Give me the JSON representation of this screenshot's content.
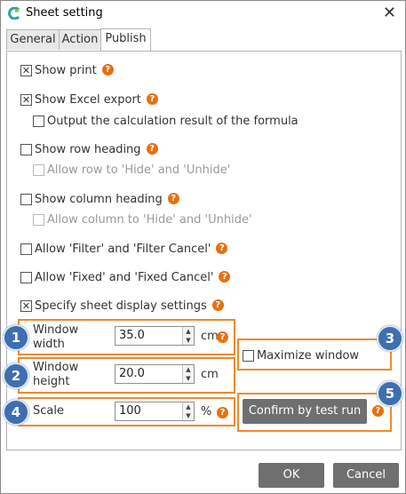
{
  "window": {
    "title": "Sheet setting",
    "close_glyph": "✕"
  },
  "tabs": [
    {
      "label": "General",
      "active": false
    },
    {
      "label": "Action",
      "active": false
    },
    {
      "label": "Publish",
      "active": true
    }
  ],
  "options": {
    "show_print": {
      "label": "Show print",
      "checked": true
    },
    "show_excel_export": {
      "label": "Show Excel export",
      "checked": true
    },
    "output_calc_result": {
      "label": "Output the calculation result of the formula",
      "checked": false
    },
    "show_row_heading": {
      "label": "Show row heading",
      "checked": false
    },
    "allow_row_hide": {
      "label": "Allow row to 'Hide' and 'Unhide'",
      "checked": false,
      "disabled": true
    },
    "show_column_heading": {
      "label": "Show column heading",
      "checked": false
    },
    "allow_column_hide": {
      "label": "Allow column to 'Hide' and 'Unhide'",
      "checked": false,
      "disabled": true
    },
    "allow_filter": {
      "label": "Allow 'Filter' and 'Filter Cancel'",
      "checked": false
    },
    "allow_fixed": {
      "label": "Allow 'Fixed' and 'Fixed Cancel'",
      "checked": false
    },
    "specify_display": {
      "label": "Specify sheet display settings",
      "checked": true
    }
  },
  "display_settings": {
    "window_width": {
      "label_line1": "Window",
      "label_line2": "width",
      "value": "35.0",
      "unit": "cm"
    },
    "window_height": {
      "label_line1": "Window",
      "label_line2": "height",
      "value": "20.0",
      "unit": "cm"
    },
    "scale": {
      "label": "Scale",
      "value": "100",
      "unit": "%"
    },
    "maximize_window": {
      "label": "Maximize window",
      "checked": false
    },
    "confirm_button": "Confirm by test run"
  },
  "badges": [
    "1",
    "2",
    "3",
    "4",
    "5"
  ],
  "help_glyph": "?",
  "check_glyph": "✕",
  "spin_up": "▲",
  "spin_down": "▼",
  "footer": {
    "ok": "OK",
    "cancel": "Cancel"
  },
  "colors": {
    "highlight_border": "#ef8a2c",
    "badge": "#3f6fb0",
    "help_icon": "#e8700f",
    "button": "#6f6f6f"
  }
}
